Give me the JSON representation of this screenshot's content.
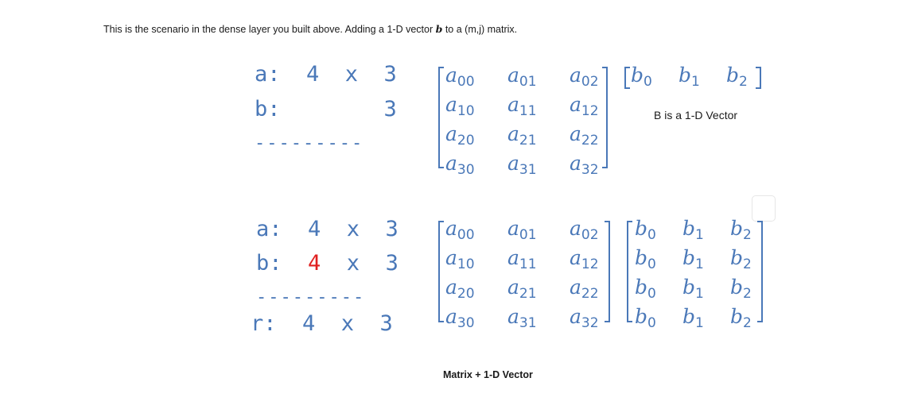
{
  "intro": {
    "text_before": "This is the scenario in the dense layer you built above. Adding a 1-D vector ",
    "vector_symbol": "b",
    "text_after": " to a (m,j) matrix."
  },
  "example1": {
    "a_line": "a:  4  x  3",
    "b_line": "b:        3",
    "separator": "---------",
    "matrix": [
      [
        "a00",
        "a01",
        "a02"
      ],
      [
        "a10",
        "a11",
        "a12"
      ],
      [
        "a20",
        "a21",
        "a22"
      ],
      [
        "a30",
        "a31",
        "a32"
      ]
    ],
    "vector": [
      "b0",
      "b1",
      "b2"
    ],
    "note": "B is a  1-D Vector"
  },
  "example2": {
    "a_line": "a:  4  x  3",
    "b_label": "b:  ",
    "b_red": "4",
    "b_rest": "  x  3",
    "separator": "---------",
    "r_line": "r:  4  x  3",
    "matrix": [
      [
        "a00",
        "a01",
        "a02"
      ],
      [
        "a10",
        "a11",
        "a12"
      ],
      [
        "a20",
        "a21",
        "a22"
      ],
      [
        "a30",
        "a31",
        "a32"
      ]
    ],
    "bmatrix": [
      [
        "b0",
        "b1",
        "b2"
      ],
      [
        "b0",
        "b1",
        "b2"
      ],
      [
        "b0",
        "b1",
        "b2"
      ],
      [
        "b0",
        "b1",
        "b2"
      ]
    ],
    "caption": "Matrix + 1-D Vector"
  },
  "colors": {
    "math": "#4a78b8",
    "highlight": "#e02020",
    "text": "#1a1a1a"
  }
}
